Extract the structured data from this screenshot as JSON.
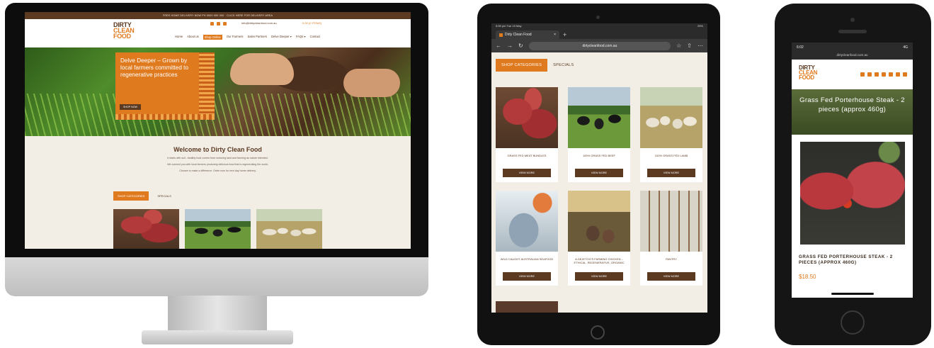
{
  "desktop": {
    "topbar": "FREE HOME DELIVERY NOW PH 0000 000 000 · CLICK HERE FOR DELIVERY AREA",
    "logo": {
      "line1": "DIRTY",
      "line2": "CLEAN",
      "line3": "FOOD"
    },
    "email": "info@dirtycleanfood.com.au",
    "cart": "0.00 (0 ITEMS)",
    "nav": [
      "Home",
      "About us",
      "Shop Online",
      "Our Farmers",
      "Sales Partners",
      "Delve Deeper ▾",
      "FAQs ▾",
      "Contact"
    ],
    "hero": {
      "title": "Delve Deeper – Grown by local farmers committed to regenerative practices",
      "button": "SHOP NOW"
    },
    "welcome": {
      "title": "Welcome to Dirty Clean Food",
      "lines": [
        "It starts with soil...healthy food comes from nurturing land and farming as nature intended.",
        "We connect you with local farmers producing delicious food that is regenerating the world.",
        "Choose to make a difference. Order now for next day home delivery."
      ]
    },
    "tabs": [
      "SHOP CATEGORIES",
      "SPECIALS"
    ]
  },
  "tablet": {
    "status": {
      "time": "5:59 pm  Tue 19 May",
      "battery": "25%"
    },
    "tab_title": "Dirty Clean Food",
    "url": "dirtycleanfood.com.au",
    "tabs": [
      "SHOP CATEGORIES",
      "SPECIALS"
    ],
    "categories": [
      {
        "name": "GRASS FED MEAT BUNDLES",
        "button": "VIEW MORE"
      },
      {
        "name": "100% GRASS FED BEEF",
        "button": "VIEW MORE"
      },
      {
        "name": "100% GRASS FED LAMB",
        "button": "VIEW MORE"
      },
      {
        "name": "WILD CAUGHT AUSTRALIAN SEAFOOD",
        "button": "VIEW MORE"
      },
      {
        "name": "A.DEJETOG'S FARMING CHICKEN – ETHICAL, REGENERATIVE, ORGANIC",
        "button": "VIEW MORE"
      },
      {
        "name": "PANTRY",
        "button": "VIEW MORE"
      }
    ]
  },
  "phone": {
    "status": {
      "time": "6:02",
      "signal": "4G"
    },
    "url": "dirtycleanfood.com.au",
    "logo": {
      "line1": "DIRTY",
      "line2": "CLEAN",
      "line3": "FOOD"
    },
    "banner": "Grass Fed Porterhouse Steak - 2 pieces (approx 460g)",
    "product_name": "GRASS FED PORTERHOUSE STEAK - 2 PIECES (APPROX 460G)",
    "price": "$18.50"
  }
}
